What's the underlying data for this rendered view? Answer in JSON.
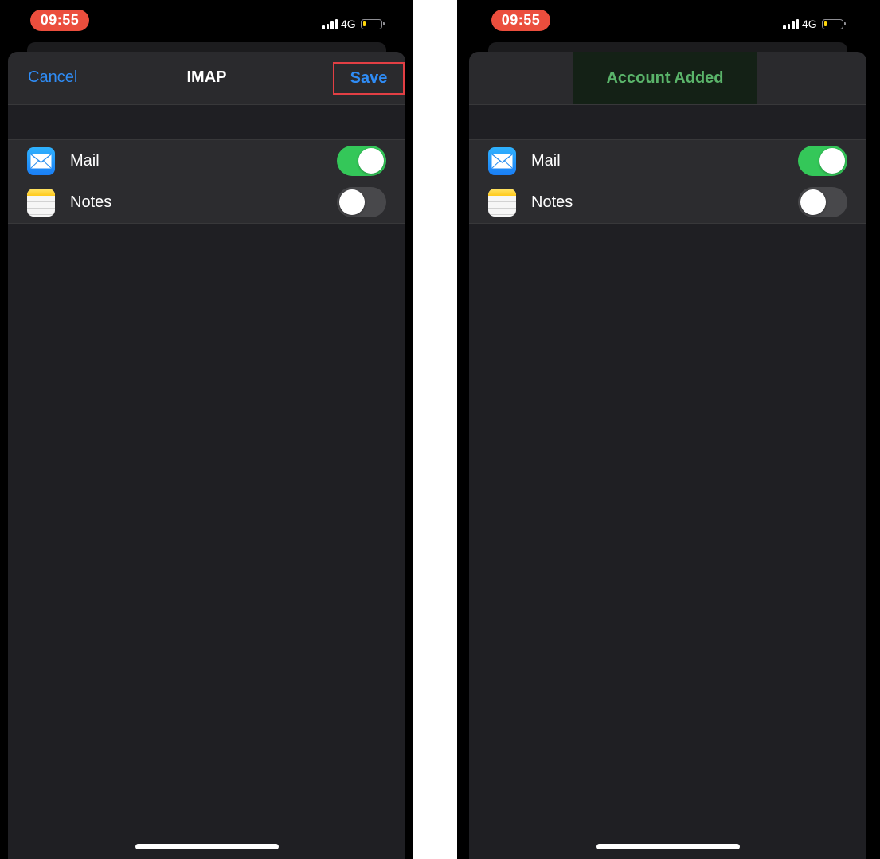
{
  "screens": [
    {
      "status_bar": {
        "time": "09:55",
        "network": "4G"
      },
      "navbar": {
        "cancel_label": "Cancel",
        "title": "IMAP",
        "save_label": "Save"
      },
      "rows": [
        {
          "label": "Mail",
          "icon": "mail-icon",
          "enabled": true
        },
        {
          "label": "Notes",
          "icon": "notes-icon",
          "enabled": false
        }
      ]
    },
    {
      "status_bar": {
        "time": "09:55",
        "network": "4G"
      },
      "toast": {
        "message": "Account Added",
        "color": "#5ab46a"
      },
      "rows": [
        {
          "label": "Mail",
          "icon": "mail-icon",
          "enabled": true
        },
        {
          "label": "Notes",
          "icon": "notes-icon",
          "enabled": false
        }
      ]
    }
  ],
  "colors": {
    "accent": "#2f8cf5",
    "toggle_on": "#34c759",
    "time_pill": "#eb4e3d",
    "highlight_box": "#e23f44"
  }
}
